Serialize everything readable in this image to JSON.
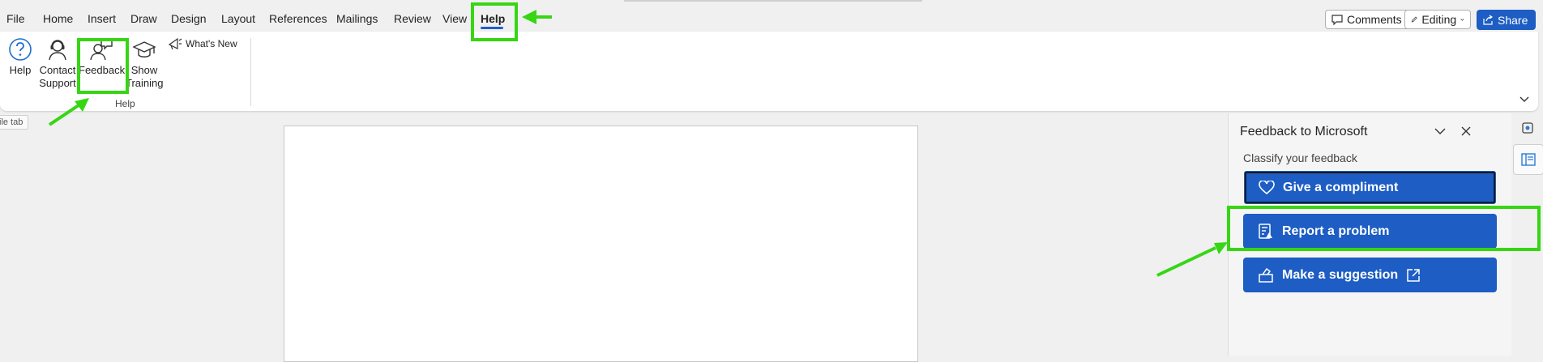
{
  "menu": {
    "tabs": [
      "File",
      "Home",
      "Insert",
      "Draw",
      "Design",
      "Layout",
      "References",
      "Mailings",
      "Review",
      "View",
      "Help"
    ],
    "active_tab": "Help"
  },
  "top_right": {
    "comments_label": "Comments",
    "editing_label": "Editing",
    "share_label": "Share"
  },
  "ribbon": {
    "help_group": {
      "group_label": "Help",
      "help_label": "Help",
      "contact_support_line1": "Contact",
      "contact_support_line2": "Support",
      "feedback_label": "Feedback",
      "show_training_line1": "Show",
      "show_training_line2": "Training",
      "whats_new_label": "What's New"
    }
  },
  "tooltip": {
    "text": "ile tab"
  },
  "feedback_pane": {
    "title": "Feedback to Microsoft",
    "subtitle": "Classify your feedback",
    "buttons": {
      "compliment": "Give a compliment",
      "problem": "Report a problem",
      "suggestion": "Make a suggestion"
    }
  },
  "colors": {
    "accent": "#1d5dc4",
    "highlight": "#36d614",
    "background": "#f0f0f0"
  }
}
